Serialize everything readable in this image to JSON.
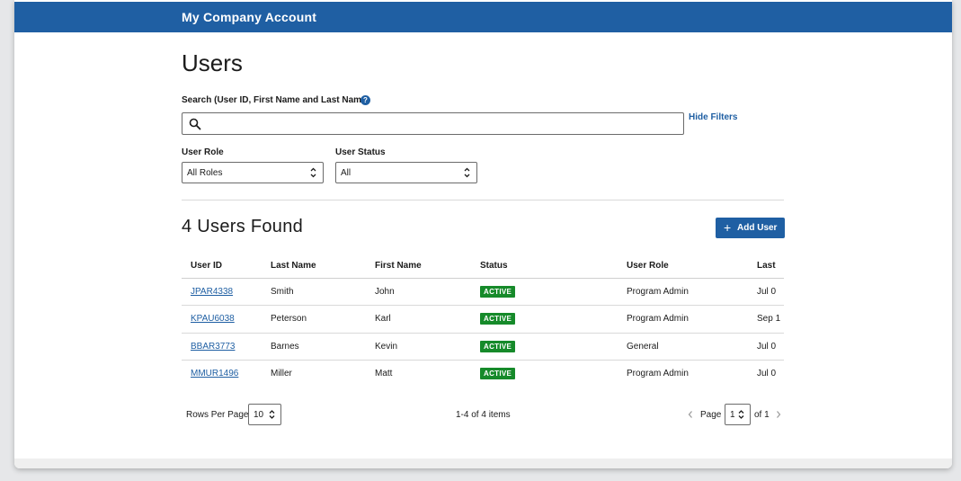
{
  "header": {
    "title": "My Company Account"
  },
  "page": {
    "title": "Users"
  },
  "search": {
    "label": "Search (User ID, First Name and Last Name)",
    "help_icon": "?",
    "value": "",
    "placeholder": ""
  },
  "filters": {
    "hide_label": "Hide Filters",
    "user_role": {
      "label": "User Role",
      "selected": "All Roles"
    },
    "user_status": {
      "label": "User Status",
      "selected": "All"
    }
  },
  "results": {
    "found_label": "4 Users Found",
    "add_button": {
      "icon": "+",
      "label": "Add User"
    }
  },
  "table": {
    "columns": [
      "User ID",
      "Last Name",
      "First Name",
      "Status",
      "User Role",
      "Last"
    ],
    "rows": [
      {
        "user_id": "JPAR4338",
        "last_name": "Smith",
        "first_name": "John",
        "status": "ACTIVE",
        "role": "Program Admin",
        "last": "Jul 0"
      },
      {
        "user_id": "KPAU6038",
        "last_name": "Peterson",
        "first_name": "Karl",
        "status": "ACTIVE",
        "role": "Program Admin",
        "last": "Sep 1"
      },
      {
        "user_id": "BBAR3773",
        "last_name": "Barnes",
        "first_name": "Kevin",
        "status": "ACTIVE",
        "role": "General",
        "last": "Jul 0"
      },
      {
        "user_id": "MMUR1496",
        "last_name": "Miller",
        "first_name": "Matt",
        "status": "ACTIVE",
        "role": "Program Admin",
        "last": "Jul 0"
      }
    ]
  },
  "pagination": {
    "rows_per_page_label": "Rows Per Page",
    "rows_per_page": "10",
    "items_summary": "1-4 of 4 items",
    "page_label": "Page",
    "current_page": "1",
    "of_total": "of 1"
  },
  "colors": {
    "brand": "#1f5fa3",
    "active_badge": "#168a2a"
  }
}
